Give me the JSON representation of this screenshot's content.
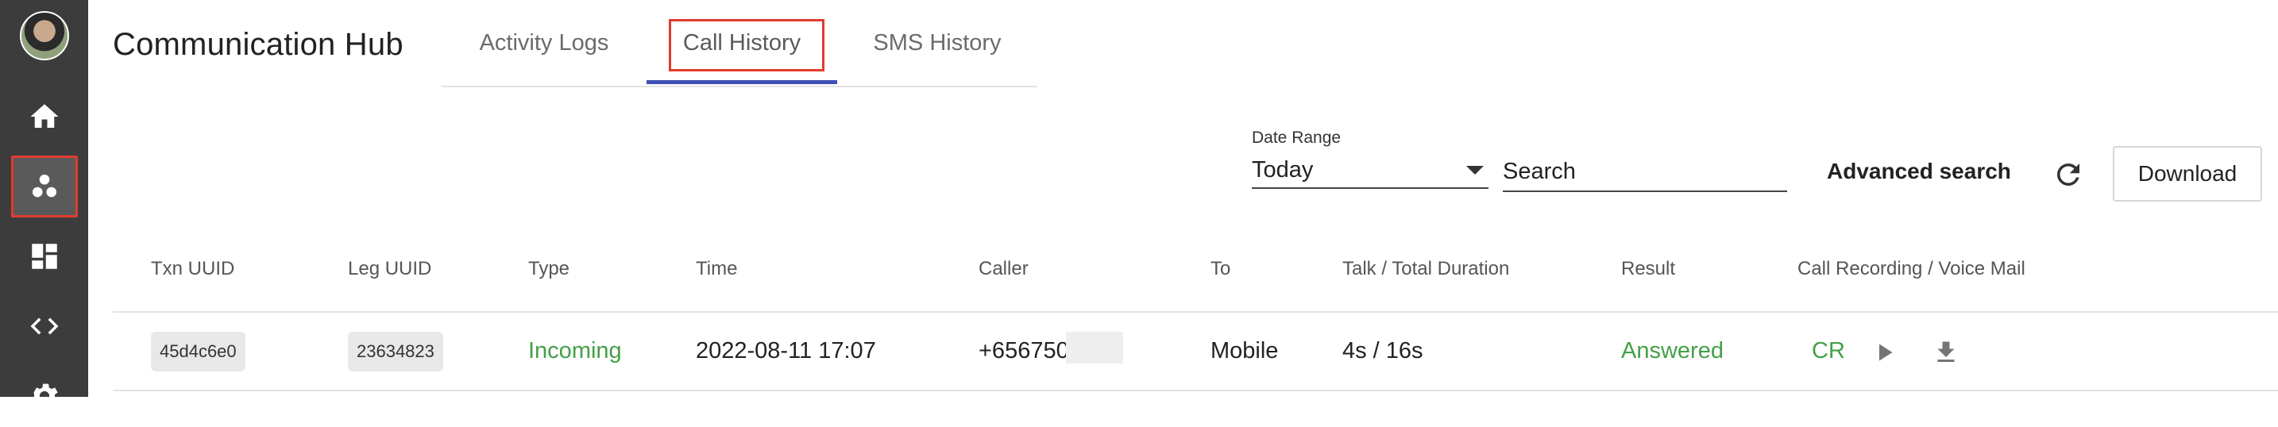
{
  "app": {
    "title": "Communication Hub"
  },
  "sidebar": {
    "items": [
      {
        "icon": "home-icon"
      },
      {
        "icon": "people-icon",
        "active": true
      },
      {
        "icon": "dashboard-icon"
      },
      {
        "icon": "code-icon"
      },
      {
        "icon": "gear-icon"
      }
    ]
  },
  "tabs": [
    {
      "label": "Activity Logs"
    },
    {
      "label": "Call History",
      "active": true
    },
    {
      "label": "SMS History"
    }
  ],
  "filters": {
    "date_range_label": "Date Range",
    "date_range_value": "Today",
    "search_placeholder": "Search",
    "advanced_search_label": "Advanced search",
    "download_label": "Download"
  },
  "table": {
    "columns": [
      "Txn UUID",
      "Leg UUID",
      "Type",
      "Time",
      "Caller",
      "To",
      "Talk / Total Duration",
      "Result",
      "Call Recording / Voice Mail"
    ],
    "rows": [
      {
        "txn_uuid": "45d4c6e0",
        "leg_uuid": "23634823",
        "type": "Incoming",
        "time": "2022-08-11 17:07",
        "caller": "+656750",
        "to": "Mobile",
        "duration": "4s / 16s",
        "result": "Answered",
        "recording": "CR"
      }
    ]
  },
  "colors": {
    "sidebar_bg": "#3c3c3c",
    "accent_underline": "#3f51b5",
    "highlight_box": "#e23b2e",
    "status_green": "#43a047"
  }
}
